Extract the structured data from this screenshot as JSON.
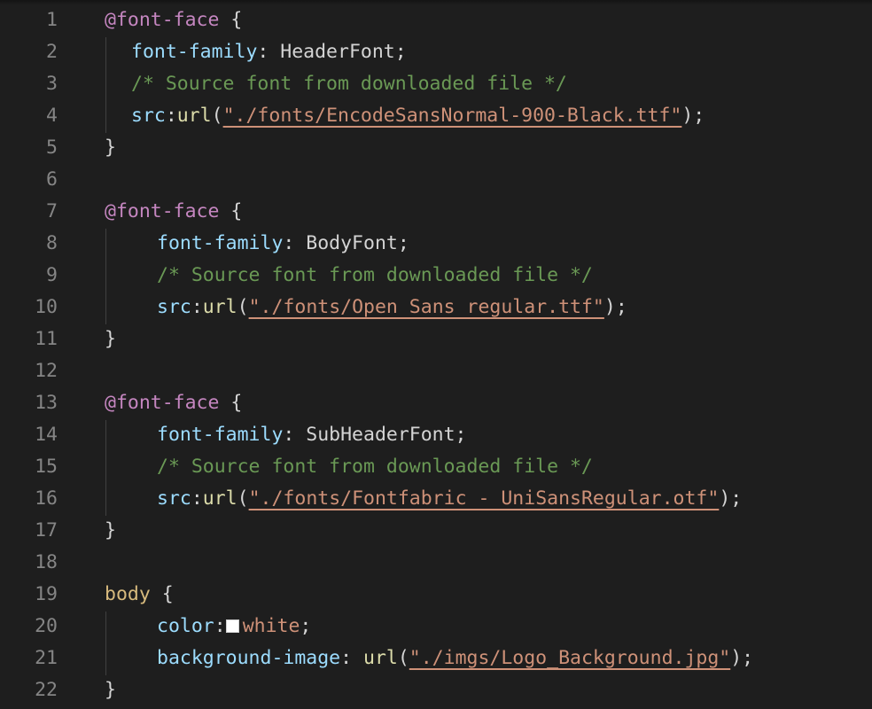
{
  "colors": {
    "background": "#1e1e1e",
    "line_number": "#858585",
    "at_rule": "#c586c0",
    "selector": "#d7ba7d",
    "property": "#9cdcfe",
    "comment": "#6a9955",
    "function": "#dcdcaa",
    "string": "#ce9178",
    "swatch_white": "#ffffff"
  },
  "lines": [
    {
      "n": "1",
      "indent": 0,
      "tokens": [
        {
          "t": "@font-face",
          "c": "at"
        },
        {
          "t": " {",
          "c": "val"
        }
      ]
    },
    {
      "n": "2",
      "indent": 1,
      "tokens": [
        {
          "t": "font-family",
          "c": "prop"
        },
        {
          "t": ": HeaderFont;",
          "c": "val"
        }
      ]
    },
    {
      "n": "3",
      "indent": 1,
      "tokens": [
        {
          "t": "/* Source font from downloaded file */",
          "c": "cmt"
        }
      ]
    },
    {
      "n": "4",
      "indent": 1,
      "tokens": [
        {
          "t": "src",
          "c": "prop"
        },
        {
          "t": ":",
          "c": "val"
        },
        {
          "t": "url",
          "c": "fn"
        },
        {
          "t": "(",
          "c": "val"
        },
        {
          "t": "\"./fonts/EncodeSansNormal-900-Black.ttf\"",
          "c": "str"
        },
        {
          "t": ");",
          "c": "val"
        }
      ]
    },
    {
      "n": "5",
      "indent": 0,
      "tokens": [
        {
          "t": "}",
          "c": "val"
        }
      ]
    },
    {
      "n": "6",
      "indent": 0,
      "tokens": []
    },
    {
      "n": "7",
      "indent": 0,
      "tokens": [
        {
          "t": "@font-face",
          "c": "at"
        },
        {
          "t": " {",
          "c": "val"
        }
      ]
    },
    {
      "n": "8",
      "indent": 2,
      "tokens": [
        {
          "t": "font-family",
          "c": "prop"
        },
        {
          "t": ": BodyFont;",
          "c": "val"
        }
      ]
    },
    {
      "n": "9",
      "indent": 2,
      "tokens": [
        {
          "t": "/* Source font from downloaded file */",
          "c": "cmt"
        }
      ]
    },
    {
      "n": "10",
      "indent": 2,
      "tokens": [
        {
          "t": "src",
          "c": "prop"
        },
        {
          "t": ":",
          "c": "val"
        },
        {
          "t": "url",
          "c": "fn"
        },
        {
          "t": "(",
          "c": "val"
        },
        {
          "t": "\"./fonts/Open Sans regular.ttf\"",
          "c": "str"
        },
        {
          "t": ");",
          "c": "val"
        }
      ]
    },
    {
      "n": "11",
      "indent": 0,
      "tokens": [
        {
          "t": "}",
          "c": "val"
        }
      ]
    },
    {
      "n": "12",
      "indent": 0,
      "tokens": []
    },
    {
      "n": "13",
      "indent": 0,
      "tokens": [
        {
          "t": "@font-face",
          "c": "at"
        },
        {
          "t": " {",
          "c": "val"
        }
      ]
    },
    {
      "n": "14",
      "indent": 2,
      "tokens": [
        {
          "t": "font-family",
          "c": "prop"
        },
        {
          "t": ": SubHeaderFont;",
          "c": "val"
        }
      ]
    },
    {
      "n": "15",
      "indent": 2,
      "tokens": [
        {
          "t": "/* Source font from downloaded file */",
          "c": "cmt"
        }
      ]
    },
    {
      "n": "16",
      "indent": 2,
      "tokens": [
        {
          "t": "src",
          "c": "prop"
        },
        {
          "t": ":",
          "c": "val"
        },
        {
          "t": "url",
          "c": "fn"
        },
        {
          "t": "(",
          "c": "val"
        },
        {
          "t": "\"./fonts/Fontfabric - UniSansRegular.otf\"",
          "c": "str"
        },
        {
          "t": ");",
          "c": "val"
        }
      ]
    },
    {
      "n": "17",
      "indent": 0,
      "tokens": [
        {
          "t": "}",
          "c": "val"
        }
      ]
    },
    {
      "n": "18",
      "indent": 0,
      "tokens": []
    },
    {
      "n": "19",
      "indent": 0,
      "tokens": [
        {
          "t": "body",
          "c": "sel"
        },
        {
          "t": " {",
          "c": "val"
        }
      ]
    },
    {
      "n": "20",
      "indent": 2,
      "tokens": [
        {
          "t": "color",
          "c": "prop"
        },
        {
          "t": ":",
          "c": "val"
        },
        {
          "swatch": "white"
        },
        {
          "t": "white",
          "c": "str-plain"
        },
        {
          "t": ";",
          "c": "val"
        }
      ]
    },
    {
      "n": "21",
      "indent": 2,
      "tokens": [
        {
          "t": "background-image",
          "c": "prop"
        },
        {
          "t": ": ",
          "c": "val"
        },
        {
          "t": "url",
          "c": "fn"
        },
        {
          "t": "(",
          "c": "val"
        },
        {
          "t": "\"./imgs/Logo_Background.jpg\"",
          "c": "str"
        },
        {
          "t": ");",
          "c": "val"
        }
      ]
    },
    {
      "n": "22",
      "indent": 0,
      "tokens": [
        {
          "t": "}",
          "c": "val"
        }
      ]
    }
  ]
}
